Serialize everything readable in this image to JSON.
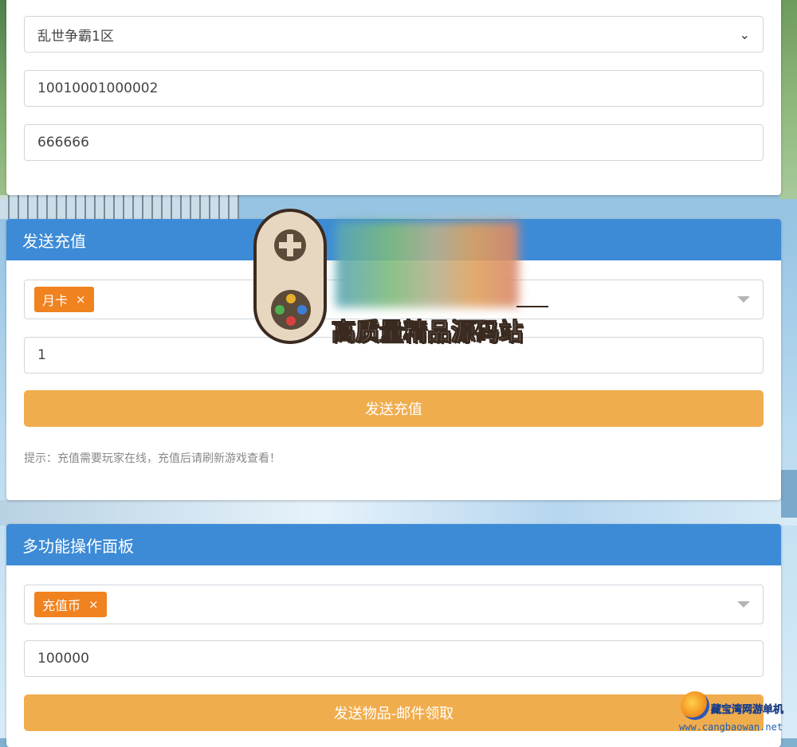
{
  "login_card": {
    "server_select": {
      "value": "乱世争霸1区"
    },
    "account_input": {
      "value": "10010001000002"
    },
    "password_input": {
      "value": "666666"
    }
  },
  "recharge_card": {
    "title": "发送充值",
    "item_tag": {
      "label": "月卡",
      "remove": "×"
    },
    "amount_input": {
      "value": "1"
    },
    "submit_label": "发送充值",
    "hint": "提示：充值需要玩家在线，充值后请刷新游戏查看！"
  },
  "multi_card": {
    "title": "多功能操作面板",
    "item_tag": {
      "label": "充值币",
      "remove": "×"
    },
    "amount_input": {
      "value": "100000"
    },
    "submit_label": "发送物品-邮件领取"
  },
  "watermark": {
    "text": "高质量精品源码站"
  },
  "corner_logo": {
    "name": "藏宝湾网游单机",
    "url": "www.cangbaowan.net"
  },
  "colors": {
    "header_blue": "#3d8bd6",
    "button_orange": "#f0ad4e",
    "tag_orange": "#f0821f"
  }
}
